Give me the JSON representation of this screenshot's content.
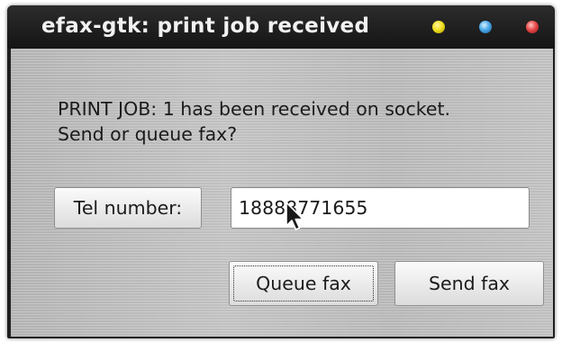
{
  "window": {
    "title": "efax-gtk: print job received",
    "controls": {
      "minimize_color": "#f0e020",
      "maximize_color": "#4aa8e8",
      "close_color": "#e84848"
    }
  },
  "dialog": {
    "message_line1": "PRINT JOB: 1 has been received on socket.",
    "message_line2": "Send or queue fax?",
    "tel_button_label": "Tel number:",
    "tel_value": "18888771655",
    "queue_button_label": "Queue fax",
    "send_button_label": "Send fax"
  }
}
